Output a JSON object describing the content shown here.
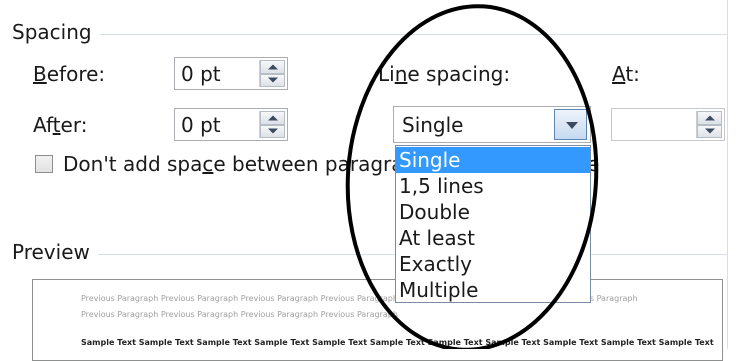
{
  "spacing": {
    "title": "Spacing",
    "before": {
      "label": "Before:",
      "accel": "B",
      "rest": "efore:",
      "value": "0 pt"
    },
    "after": {
      "label": "After:",
      "accel_pre": "Af",
      "accel": "t",
      "rest": "er:",
      "value": "0 pt"
    },
    "line_spacing": {
      "label": "Line spacing:",
      "pre": "Li",
      "accel": "n",
      "rest": "e spacing:",
      "value": "Single"
    },
    "at": {
      "label": "At:",
      "accel": "A",
      "rest": "t:",
      "value": ""
    },
    "checkbox": {
      "pre": "Don't add spa",
      "accel": "c",
      "rest": "e between paragra",
      "tail": "e",
      "checked": false
    }
  },
  "dropdown": {
    "options": [
      "Single",
      "1,5 lines",
      "Double",
      "At least",
      "Exactly",
      "Multiple"
    ],
    "selected": "Single"
  },
  "preview": {
    "title": "Preview",
    "line1": "Previous Paragraph Previous Paragraph Previous Paragraph Previous Paragraph Previous Paragraph Previous Paragraph Previous Paragraph",
    "line2": "Previous Paragraph Previous Paragraph Previous Paragraph Previous Paragraph",
    "line3": "Sample Text Sample Text Sample Text Sample Text Sample Text Sample Text Sample Text Sample Text Sample Text Sample Text Sample Text"
  },
  "colors": {
    "selection": "#3399ff",
    "annotation": "#000000",
    "rule": "#d5dfe5"
  }
}
